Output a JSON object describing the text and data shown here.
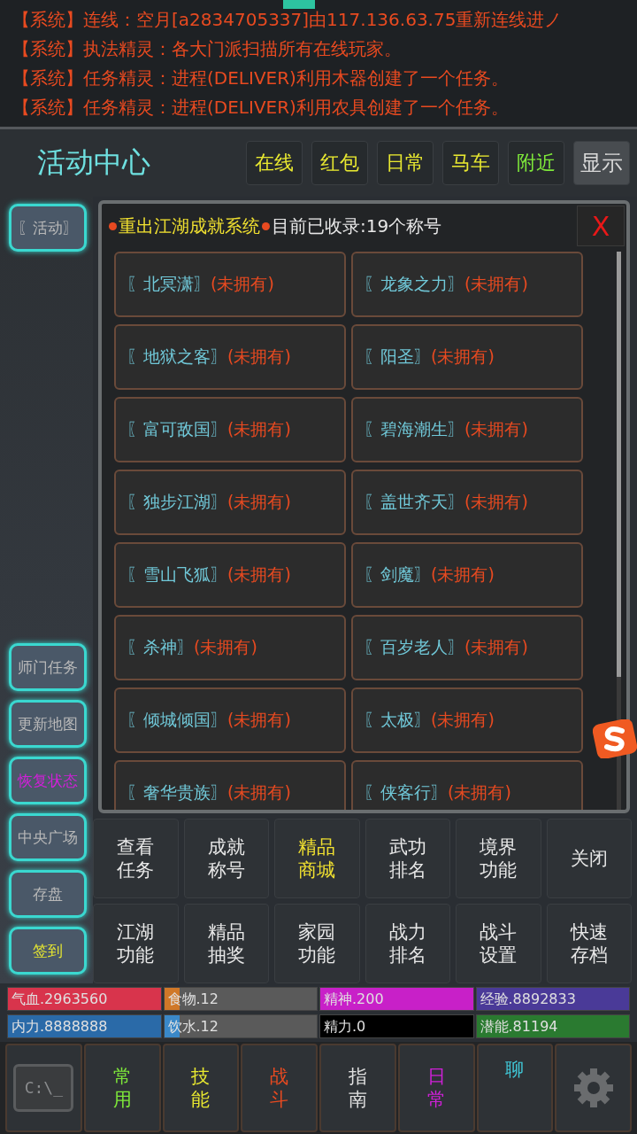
{
  "messages": [
    {
      "tag": "【系统】",
      "text": "连线：空月[a2834705337]由117.136.63.75重新连线进ノ"
    },
    {
      "tag": "【系统】",
      "text": "执法精灵：各大门派扫描所有在线玩家。"
    },
    {
      "tag": "【系统】",
      "text": "任务精灵：进程(DELIVER)利用木器创建了一个任务。"
    },
    {
      "tag": "【系统】",
      "text": "任务精灵：进程(DELIVER)利用农具创建了一个任务。"
    }
  ],
  "header": {
    "title": "活动中心",
    "tabs": [
      {
        "label": "在线",
        "kind": "tab",
        "color": "#e8e830"
      },
      {
        "label": "红包",
        "kind": "tab",
        "color": "#e8e830"
      },
      {
        "label": "日常",
        "kind": "tab",
        "color": "#e8e830"
      },
      {
        "label": "马车",
        "kind": "tab",
        "color": "#e8e830"
      },
      {
        "label": "附近",
        "kind": "tab",
        "color": "#7ee83a"
      },
      {
        "label": "显示",
        "kind": "button",
        "color": "#d8d8d8"
      }
    ]
  },
  "sidebar": {
    "top": [
      {
        "label": "〖活动〗",
        "color": "#b8b8b8"
      }
    ],
    "bottom": [
      {
        "label": "师门任务",
        "color": "#b8b8b8"
      },
      {
        "label": "更新地图",
        "color": "#b8b8b8"
      },
      {
        "label": "恢复状态",
        "color": "#d020d8"
      },
      {
        "label": "中央广场",
        "color": "#b8b8b8"
      },
      {
        "label": "存盘",
        "color": "#b8b8b8"
      },
      {
        "label": "签到",
        "color": "#e8e830"
      }
    ]
  },
  "panel": {
    "title": "重出江湖成就系统",
    "summary": "目前已收录:19个称号",
    "close": "X",
    "titles": [
      {
        "name": "〖北冥潇〗",
        "status": "(未拥有)"
      },
      {
        "name": "〖龙象之力〗",
        "status": "(未拥有)"
      },
      {
        "name": "〖地狱之客〗",
        "status": "(未拥有)"
      },
      {
        "name": "〖阳圣〗",
        "status": "(未拥有)"
      },
      {
        "name": "〖富可敌国〗",
        "status": "(未拥有)"
      },
      {
        "name": "〖碧海潮生〗",
        "status": "(未拥有)"
      },
      {
        "name": "〖独步江湖〗",
        "status": "(未拥有)"
      },
      {
        "name": "〖盖世齐天〗",
        "status": "(未拥有)"
      },
      {
        "name": "〖雪山飞狐〗",
        "status": "(未拥有)"
      },
      {
        "name": "〖剑魔〗",
        "status": "(未拥有)"
      },
      {
        "name": "〖杀神〗",
        "status": "(未拥有)"
      },
      {
        "name": "〖百岁老人〗",
        "status": "(未拥有)"
      },
      {
        "name": "〖倾城倾国〗",
        "status": "(未拥有)"
      },
      {
        "name": "〖太极〗",
        "status": "(未拥有)"
      },
      {
        "name": "〖奢华贵族〗",
        "status": "(未拥有)"
      },
      {
        "name": "〖侠客行〗",
        "status": "(未拥有)"
      }
    ]
  },
  "functions": [
    {
      "label": "查看任务",
      "highlighted": false
    },
    {
      "label": "成就称号",
      "highlighted": false
    },
    {
      "label": "精品商城",
      "highlighted": true
    },
    {
      "label": "武功排名",
      "highlighted": false
    },
    {
      "label": "境界功能",
      "highlighted": false
    },
    {
      "label": "关闭",
      "highlighted": false
    },
    {
      "label": "江湖功能",
      "highlighted": false
    },
    {
      "label": "精品抽奖",
      "highlighted": false
    },
    {
      "label": "家园功能",
      "highlighted": false
    },
    {
      "label": "战力排名",
      "highlighted": false
    },
    {
      "label": "战斗设置",
      "highlighted": false
    },
    {
      "label": "快速存档",
      "highlighted": false
    }
  ],
  "stats": [
    {
      "label": "气血.2963560",
      "level": 1,
      "color": "#d8344c"
    },
    {
      "label": "食物.12",
      "level": 0.1,
      "color": "#d07828"
    },
    {
      "label": "精神.200",
      "level": 1,
      "color": "#c820c8"
    },
    {
      "label": "经验.8892833",
      "level": 1,
      "color": "#4a3a98"
    },
    {
      "label": "内力.8888888",
      "level": 1,
      "color": "#2a6aa8"
    },
    {
      "label": "饮水.12",
      "level": 0.1,
      "color": "#3a88c8"
    },
    {
      "label": "精力.0"
    },
    {
      "label": "潜能.81194",
      "level": 1,
      "color": "#2a7a30"
    }
  ],
  "nav": [
    {
      "kind": "terminal",
      "label": "C:\\_"
    },
    {
      "kind": "text",
      "label": "常用",
      "color": "#7ee83a"
    },
    {
      "kind": "text",
      "label": "技能",
      "color": "#e8e830"
    },
    {
      "kind": "text",
      "label": "战斗",
      "color": "#e84a20"
    },
    {
      "kind": "text",
      "label": "指南",
      "color": "#e0e0e0"
    },
    {
      "kind": "text",
      "label": "日常",
      "color": "#d020d8"
    },
    {
      "kind": "text",
      "label": "聊",
      "color": "#40c8d8"
    },
    {
      "kind": "gear"
    }
  ]
}
